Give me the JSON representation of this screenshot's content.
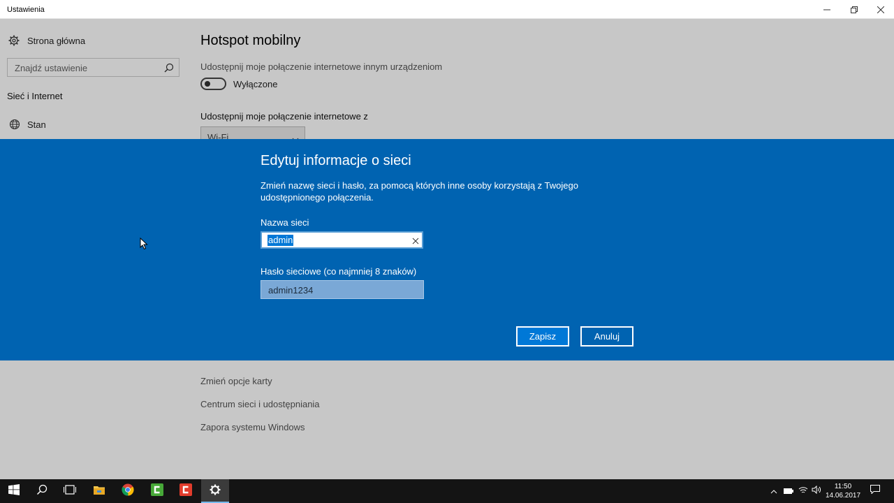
{
  "window": {
    "title": "Ustawienia"
  },
  "sidebar": {
    "home_label": "Strona główna",
    "search_placeholder": "Znajdź ustawienie",
    "section_title": "Sieć i Internet",
    "items": [
      {
        "label": "Stan",
        "icon": "globe-icon"
      }
    ]
  },
  "main": {
    "title": "Hotspot mobilny",
    "share_desc": "Udostępnij moje połączenie internetowe innym urządzeniom",
    "toggle_state": "Wyłączone",
    "share_from_label": "Udostępnij moje połączenie internetowe z",
    "share_from_value": "Wi-Fi",
    "links": [
      "Zmień opcje karty",
      "Centrum sieci i udostępniania",
      "Zapora systemu Windows"
    ]
  },
  "dialog": {
    "title": "Edytuj informacje o sieci",
    "description": "Zmień nazwę sieci i hasło, za pomocą których inne osoby korzystają z Twojego udostępnionego połączenia.",
    "network_name_label": "Nazwa sieci",
    "network_name_value": "admin",
    "password_label": "Hasło sieciowe (co najmniej 8 znaków)",
    "password_value": "admin1234",
    "save_label": "Zapisz",
    "cancel_label": "Anuluj"
  },
  "taskbar": {
    "apps": [
      "start-icon",
      "search-icon",
      "task-view-icon",
      "file-explorer-icon",
      "chrome-icon",
      "camtasia-recorder-icon",
      "camtasia-editor-icon",
      "settings-icon"
    ],
    "time": "11:50",
    "date": "14.06.2017"
  },
  "colors": {
    "dialog_bg": "#0063b1",
    "accent": "#0078d7",
    "taskbar_bg": "#141414"
  }
}
